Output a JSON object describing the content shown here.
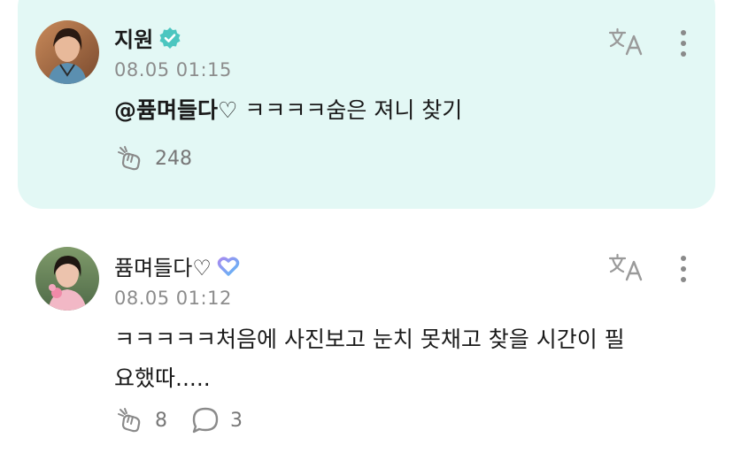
{
  "posts": [
    {
      "author": "지원",
      "verified": true,
      "timestamp": "08.05 01:15",
      "mention": "@퓸며들다♡",
      "text": " ㅋㅋㅋㅋ숨은 져니 찾기",
      "like_count": "248",
      "highlight_bg": "#e3f8f5",
      "icons": [
        "avatar",
        "verified-badge-icon",
        "translate-icon",
        "more-options-icon",
        "like-icon"
      ]
    },
    {
      "author": "퓸며들다♡",
      "verified": false,
      "timestamp": "08.05 01:12",
      "text_line1": "ㅋㅋㅋㅋㅋ처음에 사진보고 눈치 못채고 찾을 시간이 필",
      "text_line2": "요했따.....",
      "like_count": "8",
      "comment_count": "3",
      "icons": [
        "avatar",
        "membership-heart-icon",
        "translate-icon",
        "more-options-icon",
        "like-icon",
        "comment-icon"
      ]
    }
  ],
  "colors": {
    "accent_teal": "#4bc6c0",
    "membership_gradient_start": "#a58bf0",
    "membership_gradient_end": "#5fb7f5",
    "muted_text": "#8c8c8c"
  }
}
